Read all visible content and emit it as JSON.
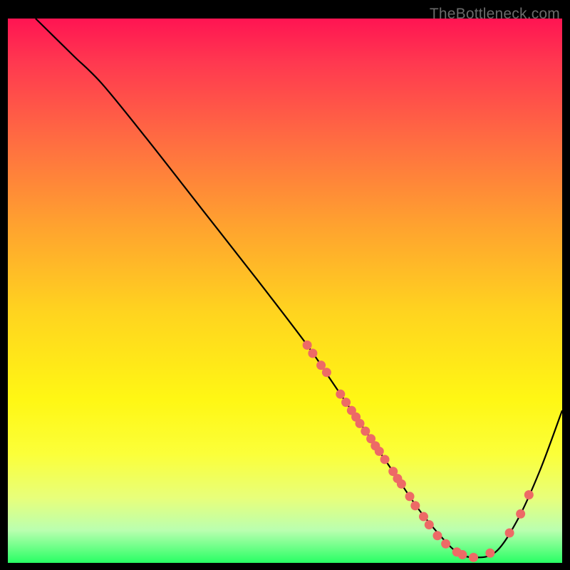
{
  "watermark": "TheBottleneck.com",
  "colors": {
    "background": "#000000",
    "curve": "#000000",
    "dot_fill": "#ed6a66",
    "dot_stroke": "#ed6a66"
  },
  "chart_data": {
    "type": "line",
    "title": "",
    "xlabel": "",
    "ylabel": "",
    "xlim": [
      0,
      100
    ],
    "ylim": [
      0,
      100
    ],
    "series": [
      {
        "name": "bottleneck-curve",
        "x": [
          5,
          8,
          12,
          17,
          25,
          35,
          45,
          54,
          58,
          62,
          66,
          70,
          74,
          78,
          81,
          84,
          88,
          92,
          96,
          100
        ],
        "values": [
          100,
          97,
          93,
          88,
          78,
          65,
          52,
          40,
          34,
          28,
          22,
          16,
          10,
          5,
          2,
          1,
          2,
          8,
          17,
          28
        ]
      }
    ],
    "dots": [
      {
        "x": 54.0,
        "y": 40
      },
      {
        "x": 55.0,
        "y": 38.5
      },
      {
        "x": 56.5,
        "y": 36.3
      },
      {
        "x": 57.5,
        "y": 35.0
      },
      {
        "x": 60.0,
        "y": 31.0
      },
      {
        "x": 61.0,
        "y": 29.5
      },
      {
        "x": 62.0,
        "y": 28.0
      },
      {
        "x": 62.8,
        "y": 26.8
      },
      {
        "x": 63.5,
        "y": 25.6
      },
      {
        "x": 64.5,
        "y": 24.2
      },
      {
        "x": 65.5,
        "y": 22.8
      },
      {
        "x": 66.3,
        "y": 21.5
      },
      {
        "x": 67.0,
        "y": 20.5
      },
      {
        "x": 68.0,
        "y": 19.0
      },
      {
        "x": 69.5,
        "y": 16.8
      },
      {
        "x": 70.3,
        "y": 15.5
      },
      {
        "x": 71.0,
        "y": 14.5
      },
      {
        "x": 72.5,
        "y": 12.2
      },
      {
        "x": 73.5,
        "y": 10.5
      },
      {
        "x": 75.0,
        "y": 8.5
      },
      {
        "x": 76.0,
        "y": 7.0
      },
      {
        "x": 77.5,
        "y": 5.0
      },
      {
        "x": 79.0,
        "y": 3.5
      },
      {
        "x": 81.0,
        "y": 2.0
      },
      {
        "x": 82.0,
        "y": 1.5
      },
      {
        "x": 84.0,
        "y": 1.0
      },
      {
        "x": 87.0,
        "y": 1.8
      },
      {
        "x": 90.5,
        "y": 5.5
      },
      {
        "x": 92.5,
        "y": 9.0
      },
      {
        "x": 94.0,
        "y": 12.5
      }
    ]
  }
}
